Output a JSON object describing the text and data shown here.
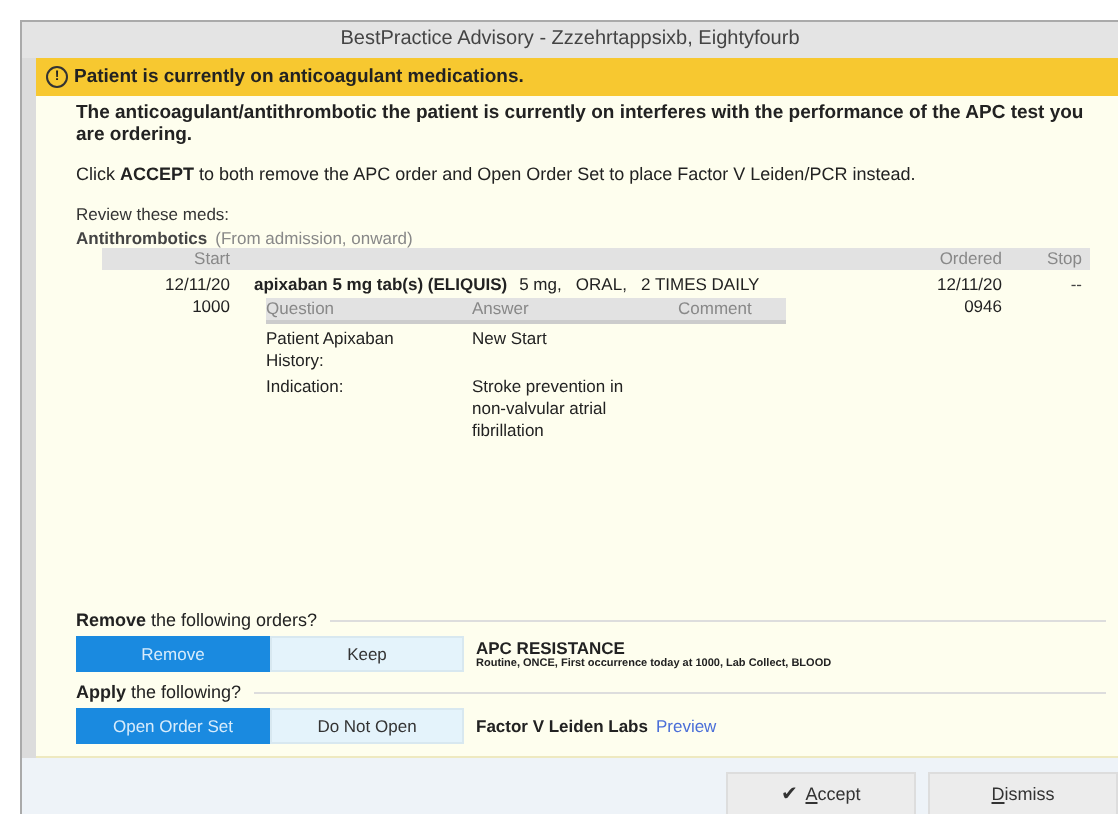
{
  "window": {
    "title": "BestPractice Advisory - Zzzehrtappsixb, Eightyfourb"
  },
  "banner": {
    "icon": "!",
    "text": "Patient is currently on anticoagulant medications."
  },
  "message": "The anticoagulant/antithrombotic the patient is currently on interferes with the performance of the APC test you are ordering.",
  "instruction": "Click **ACCEPT** to both remove the APC order and Open Order Set to place Factor V Leiden/PCR instead.",
  "review_label": "Review these meds:",
  "med_group": {
    "name": "Antithrombotics",
    "note": "(From admission, onward)"
  },
  "med_table": {
    "columns": [
      "Start",
      "Ordered",
      "Stop"
    ],
    "rows": [
      {
        "start_date": "12/11/20",
        "start_time": "1000",
        "medication": "apixaban 5 mg tab(s) (ELIQUIS)",
        "details": "5 mg,   ORAL,   2 TIMES DAILY",
        "ordered_date": "12/11/20",
        "ordered_time": "0946",
        "stop": "--",
        "questions": {
          "columns": [
            "Question",
            "Answer",
            "Comment"
          ],
          "rows": [
            {
              "question": "Patient Apixaban History:",
              "answer": "New Start"
            },
            {
              "question": "Indication:",
              "answer": "Stroke prevention in non-valvular atrial fibrillation"
            }
          ]
        }
      }
    ]
  },
  "sections": [
    {
      "heading": "**Remove** the following orders?",
      "options": [
        {
          "label": "Remove",
          "selected": true
        },
        {
          "label": "Keep",
          "selected": false
        }
      ],
      "kind": "order",
      "title": "APC RESISTANCE",
      "detail": "Routine, ONCE, First occurrence today at 1000, Lab Collect, BLOOD"
    },
    {
      "heading": "**Apply** the following?",
      "options": [
        {
          "label": "Open Order Set",
          "selected": true
        },
        {
          "label": "Do Not Open",
          "selected": false
        }
      ],
      "kind": "orderset",
      "title": "Factor V Leiden Labs",
      "link": "Preview"
    }
  ],
  "buttons": [
    {
      "label": "Accept",
      "icon": "✔"
    },
    {
      "label": "Dismiss"
    }
  ]
}
